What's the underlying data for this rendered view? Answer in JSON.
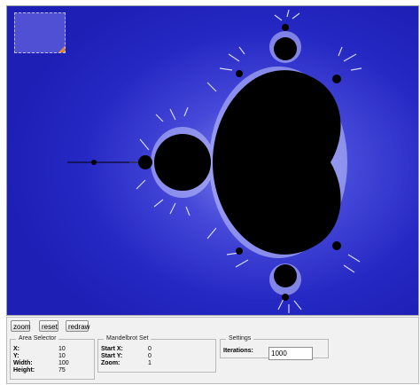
{
  "colors": {
    "background": "#1d1fb5",
    "set": "#000000",
    "selection_grip": "#e08a25"
  },
  "toolbar": {
    "zoom_label": "zoom",
    "reset_label": "reset",
    "redraw_label": "redraw"
  },
  "area_selector": {
    "legend": "Area Selector",
    "x_label": "X:",
    "x_value": "10",
    "y_label": "Y:",
    "y_value": "10",
    "width_label": "Width:",
    "width_value": "100",
    "height_label": "Height:",
    "height_value": "75"
  },
  "mandelbrot_set": {
    "legend": "Mandelbrot Set",
    "start_x_label": "Start X:",
    "start_x_value": "0",
    "start_y_label": "Start Y:",
    "start_y_value": "0",
    "zoom_label": "Zoom:",
    "zoom_value": "1"
  },
  "settings": {
    "legend": "Settings",
    "iterations_label": "Iterations:",
    "iterations_value": "1000"
  }
}
